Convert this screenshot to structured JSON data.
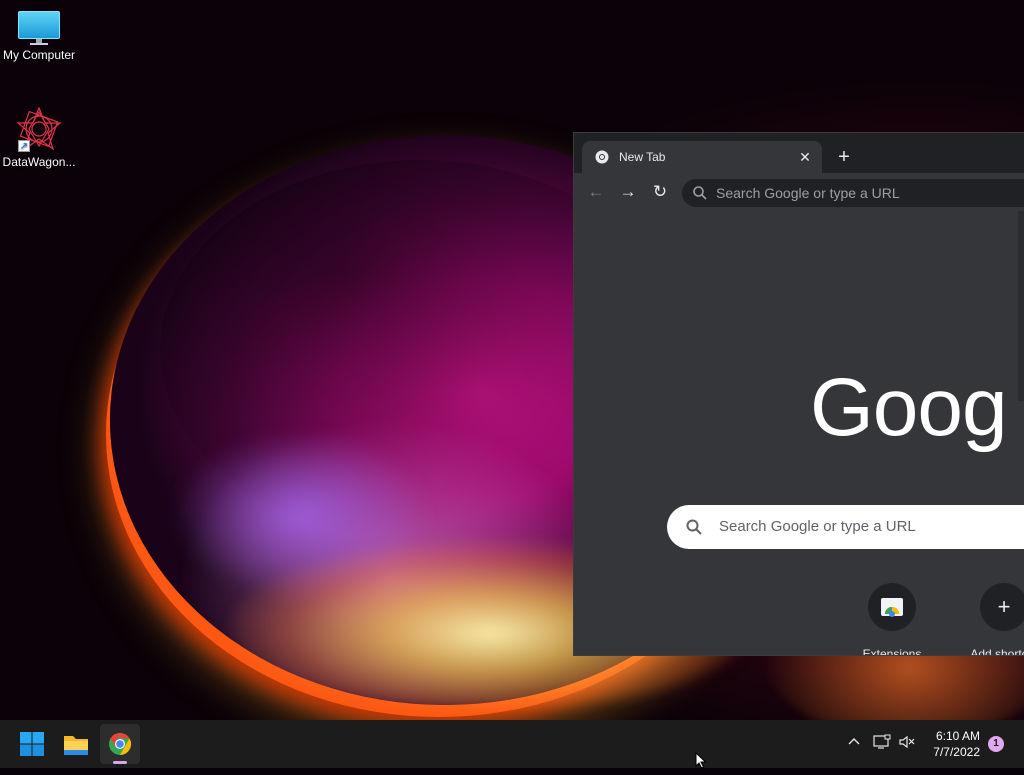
{
  "desktop": {
    "icons": [
      {
        "label": "My Computer",
        "icon": "monitor-icon"
      },
      {
        "label": "DataWagon...",
        "icon": "datawagon-logo-icon"
      }
    ]
  },
  "browser": {
    "tab": {
      "title": "New Tab",
      "close_glyph": "✕",
      "favicon": "chrome-icon"
    },
    "new_tab_glyph": "+",
    "toolbar": {
      "back": "←",
      "forward": "→",
      "reload": "↻",
      "omnibox_placeholder": "Search Google or type a URL"
    },
    "ntp": {
      "logo_text": "Goog",
      "search_placeholder": "Search Google or type a URL",
      "shortcuts": [
        {
          "label": "Extensions",
          "icon": "web-store-icon"
        },
        {
          "label": "Add shortcut",
          "glyph": "+"
        }
      ]
    }
  },
  "taskbar": {
    "buttons": [
      "windows-start-icon",
      "file-explorer-icon",
      "chrome-icon"
    ],
    "tray": {
      "chevron": "^",
      "network": "network-icon",
      "volume": "volume-muted-icon"
    },
    "clock": {
      "time": "6:10 AM",
      "date": "7/7/2022"
    },
    "notification_count": "1"
  },
  "colors": {
    "taskbar": "#1c1c1c",
    "chrome_dark": "#35363a",
    "accent_notif": "#e2a8ee"
  }
}
